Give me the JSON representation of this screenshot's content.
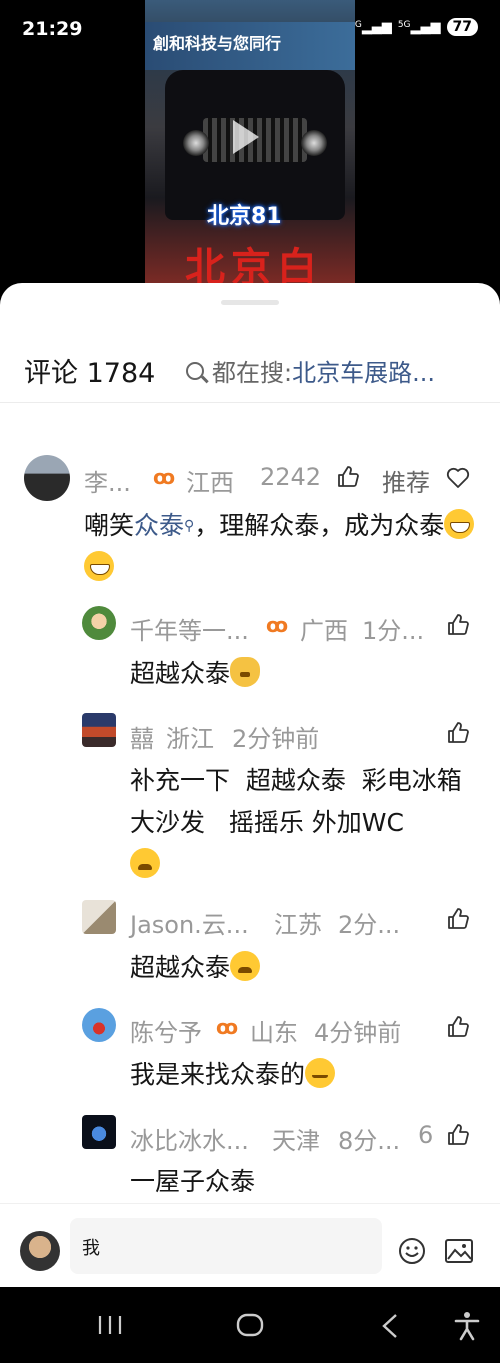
{
  "status": {
    "time": "21:29",
    "battery": "77",
    "network_1": "5G",
    "network_2": "5G"
  },
  "video": {
    "caption": "北京81",
    "banner_text": "創和科技与您同行",
    "sign_text": "北京白"
  },
  "comments_header": {
    "title": "评论 1784",
    "search_prefix": "都在搜: ",
    "search_keyword": "北京车展路..."
  },
  "comments": [
    {
      "name": "李...",
      "location": "江西",
      "likes": "2242",
      "tag": "推荐",
      "text_pre": "嘲笑",
      "text_link": "众泰",
      "text_post": "，理解众泰，成为众泰"
    },
    {
      "name": "千年等一...",
      "location": "广西",
      "time": "1分...",
      "text": "超越众泰"
    },
    {
      "name": "囍",
      "location": "浙江",
      "time": "2分钟前",
      "text": "补充一下  超越众泰  彩电冰箱大沙发   摇摇乐 外加WC"
    },
    {
      "name": "Jason.云...",
      "location": "江苏",
      "time": "2分...",
      "text": "超越众泰"
    },
    {
      "name": "陈兮予",
      "location": "山东",
      "time": "4分钟前",
      "text": "我是来找众泰的"
    },
    {
      "name": "冰比冰水...",
      "location": "天津",
      "time": "8分...",
      "likes": "6",
      "text": "一屋子众泰"
    }
  ],
  "input": {
    "value": "我"
  },
  "colors": {
    "link": "#3d5a8a",
    "badge": "#f07a22",
    "sheet": "#ffffff"
  }
}
